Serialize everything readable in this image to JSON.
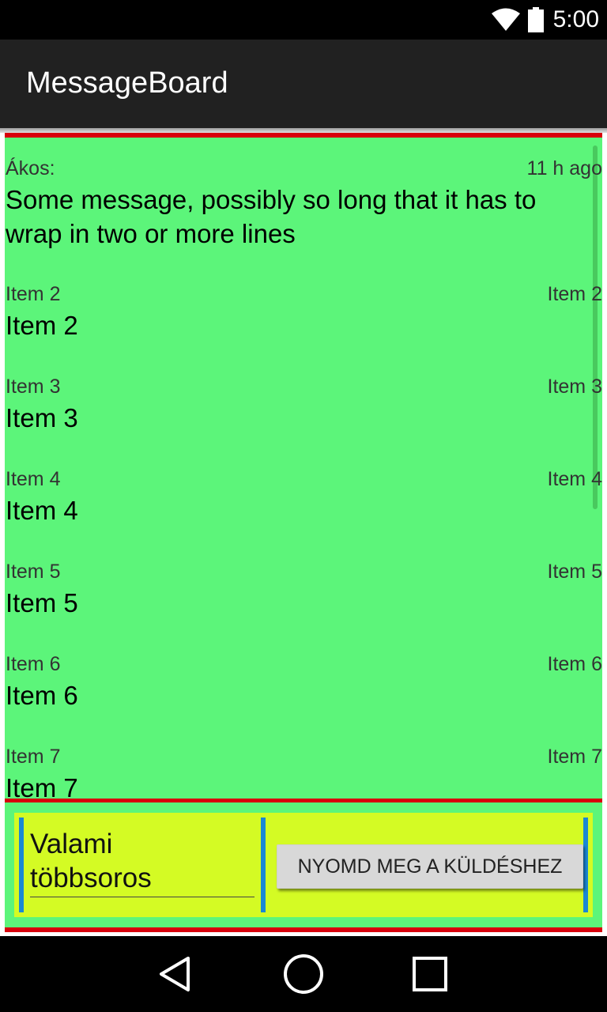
{
  "status_bar": {
    "time": "5:00",
    "icons": [
      "wifi-icon",
      "battery-icon"
    ]
  },
  "app_bar": {
    "title": "MessageBoard"
  },
  "messages": [
    {
      "author": "Ákos:",
      "time": "11 h ago",
      "text": "Some message, possibly so long that it has to wrap in two or more lines"
    },
    {
      "author": "Item 2",
      "time": "Item 2",
      "text": "Item 2"
    },
    {
      "author": "Item 3",
      "time": "Item 3",
      "text": "Item 3"
    },
    {
      "author": "Item 4",
      "time": "Item 4",
      "text": "Item 4"
    },
    {
      "author": "Item 5",
      "time": "Item 5",
      "text": "Item 5"
    },
    {
      "author": "Item 6",
      "time": "Item 6",
      "text": "Item 6"
    },
    {
      "author": "Item 7",
      "time": "Item 7",
      "text": "Item 7"
    }
  ],
  "composer": {
    "input_value": "Valami\ntöbbsoros",
    "send_label": "NYOMD MEG A KÜLDÉSHEZ"
  },
  "nav_bar": {
    "icons": [
      "back-icon",
      "home-icon",
      "recents-icon"
    ]
  },
  "colors": {
    "list_background": "#5cf57a",
    "border_red": "#d8000c",
    "composer_background": "#d4fb24",
    "accent_blue": "#1a88d4",
    "app_bar": "#212121"
  }
}
